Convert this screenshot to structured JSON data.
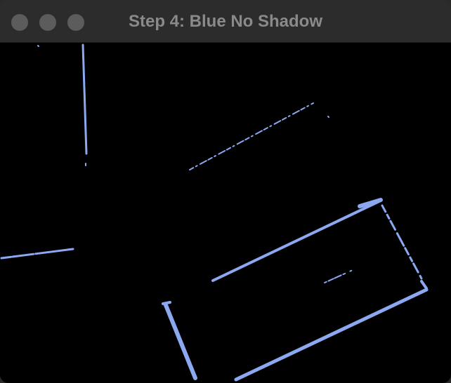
{
  "window": {
    "title": "Step 4: Blue No Shadow"
  },
  "traffic_lights": [
    {
      "name": "close-button",
      "color": "#5c5c5c"
    },
    {
      "name": "minimize-button",
      "color": "#5c5c5c"
    },
    {
      "name": "zoom-button",
      "color": "#5c5c5c"
    }
  ],
  "colors": {
    "background": "#000000",
    "titlebar": "#2c2c2c",
    "title_text": "#8a8a8a",
    "edge_stroke": "#8ba8f0"
  }
}
